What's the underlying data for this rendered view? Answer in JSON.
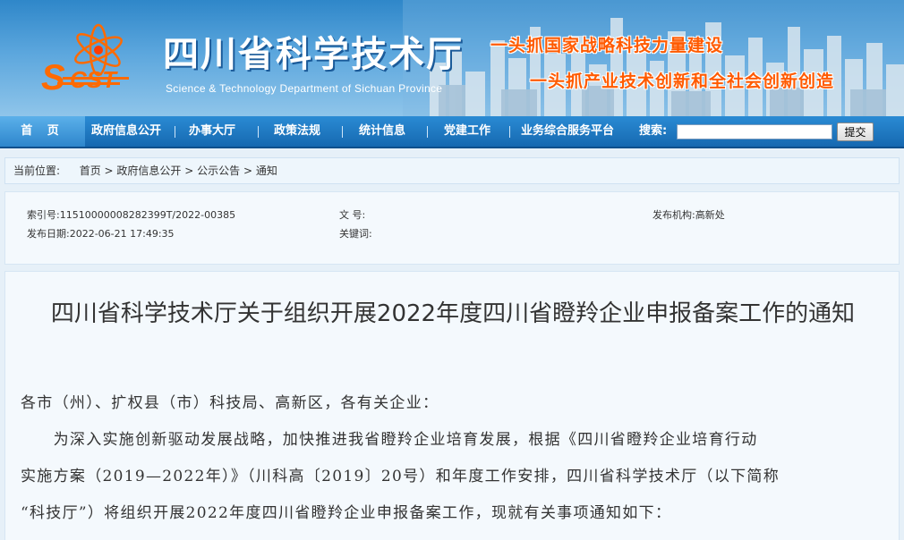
{
  "header": {
    "logo_text": "SCST",
    "site_title": "四川省科学技术厅",
    "site_subtitle": "Science & Technology Department of Sichuan Province",
    "slogan_1": "一头抓国家战略科技力量建设",
    "slogan_2": "一头抓产业技术创新和全社会创新创造"
  },
  "nav": {
    "home": "首 页",
    "items": [
      "政府信息公开",
      "办事大厅",
      "政策法规",
      "统计信息",
      "党建工作",
      "业务综合服务平台"
    ],
    "search_label": "搜索:",
    "search_value": "",
    "search_button": "提交"
  },
  "breadcrumb": {
    "prefix": "当前位置:",
    "items": [
      "首页",
      "政府信息公开",
      "公示公告",
      "通知"
    ],
    "separator": " > "
  },
  "meta": {
    "index_label": "索引号:",
    "index_value": "11510000008282399T/2022-00385",
    "doc_no_label": "文 号:",
    "doc_no_value": "",
    "publisher_label": "发布机构:",
    "publisher_value": "高新处",
    "date_label": "发布日期:",
    "date_value": "2022-06-21 17:49:35",
    "keywords_label": "关键词:",
    "keywords_value": ""
  },
  "article": {
    "title": "四川省科学技术厅关于组织开展2022年度四川省瞪羚企业申报备案工作的通知",
    "salutation": "各市（州）、扩权县（市）科技局、高新区，各有关企业：",
    "body_line_1": "　　为深入实施创新驱动发展战略，加快推进我省瞪羚企业培育发展，根据《四川省瞪羚企业培育行动",
    "body_line_2": "实施方案（2019—2022年）》（川科高〔2019〕20号）和年度工作安排，四川省科学技术厅（以下简称",
    "body_line_3": "“科技厅”）将组织开展2022年度四川省瞪羚企业申报备案工作，现就有关事项通知如下："
  },
  "colors": {
    "nav_bg": "#1a6fb6",
    "slogan": "#ff5a00",
    "banner_top": "#2f87c9"
  }
}
